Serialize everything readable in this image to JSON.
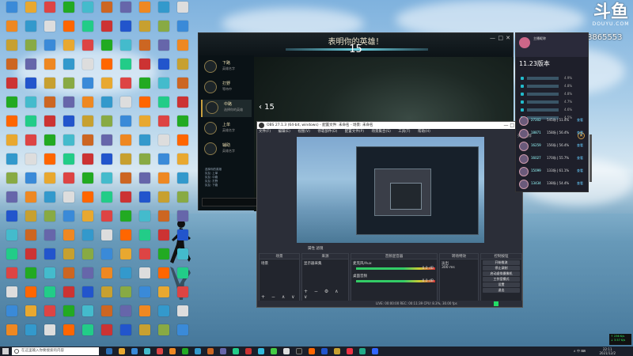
{
  "colors": {
    "sky_top": "#7fb2de",
    "obs_bg": "#2b2e38",
    "danmu_bg": "#1e1f2a",
    "taskbar": "#1a1f2a",
    "accent_cyan": "#6bd0e0",
    "game_gold": "#c8a040"
  },
  "douyu": {
    "logo_mark": "斗鱼",
    "brand": "DOUYU.COM",
    "room_id": "8865553"
  },
  "game": {
    "title": "表明你的英雄！",
    "timer": "15",
    "win_controls": [
      "—",
      "□",
      "✕"
    ],
    "roles": [
      {
        "name": "下路",
        "sub": "英雄名字"
      },
      {
        "name": "打野",
        "sub": "等待中"
      },
      {
        "name": "中路",
        "sub": "选择你的英雄"
      },
      {
        "name": "上单",
        "sub": "英雄名字"
      },
      {
        "name": "辅助",
        "sub": "英雄名字"
      }
    ],
    "count": "‹ 15",
    "chat": [
      "选择你的英雄",
      "队友: 上单",
      "队友: 中路",
      "队友: 打野",
      "队友: 下路"
    ]
  },
  "obs": {
    "title": "OBS 27.1.3 (64-bit, windows) - 配置文件: 未命名 - 场景: 未命名",
    "menu": [
      "文件(F)",
      "编辑(E)",
      "视图(V)",
      "停靠部件(D)",
      "配置文件(P)",
      "场景集合(S)",
      "工具(T)",
      "帮助(H)"
    ],
    "controls_label": "属性   滤镜",
    "scenes_header": "场景",
    "scenes": [
      "场景"
    ],
    "sources_header": "来源",
    "sources": [
      "显示器采集"
    ],
    "mixer_header": "音频混音器",
    "mixer": [
      {
        "name": "麦克风/Aux",
        "db": "0.0 dB"
      },
      {
        "name": "桌面音频",
        "db": "0.0 dB"
      }
    ],
    "transitions_header": "转场特效",
    "transition": "淡出",
    "duration": "300 ms",
    "controls_header": "控制按钮",
    "buttons": [
      "开始推流",
      "停止录制",
      "启动虚拟摄像机",
      "工作室模式",
      "设置",
      "退出"
    ],
    "status": "LIVE: 00:00:00   REC: 00:11:39   CPU: 8.3%, 30.00 fps"
  },
  "danmu": {
    "header_name": "主播昵称",
    "version": "11.23版本",
    "ranks": [
      {
        "value": "4.9%"
      },
      {
        "value": "4.8%"
      },
      {
        "value": "4.8%"
      },
      {
        "value": "4.7%"
      },
      {
        "value": "4.6%"
      },
      {
        "value": "4.5%"
      }
    ],
    "section": "英雄推荐",
    "close": "✕",
    "heroes": [
      {
        "a": "27202",
        "b": "545场 | 51.4%",
        "l": "查看"
      },
      {
        "a": "18871",
        "b": "158场 | 56.4%",
        "l": "查看"
      },
      {
        "a": "16259",
        "b": "156场 | 56.4%",
        "l": "查看"
      },
      {
        "a": "16027",
        "b": "170场 | 55.7%",
        "l": "查看"
      },
      {
        "a": "15099",
        "b": "133场 | 61.1%",
        "l": "查看"
      },
      {
        "a": "13434",
        "b": "138场 | 54.4%",
        "l": "查看"
      }
    ]
  },
  "taskbar": {
    "search_placeholder": "在这里输入你要搜索的内容",
    "time": "22:11",
    "date": "2021/12/2",
    "sys": "∧ 中 ⌨"
  },
  "netmon": {
    "up": "↑ 236 K/s",
    "down": "↓ 3.57 K/s"
  }
}
